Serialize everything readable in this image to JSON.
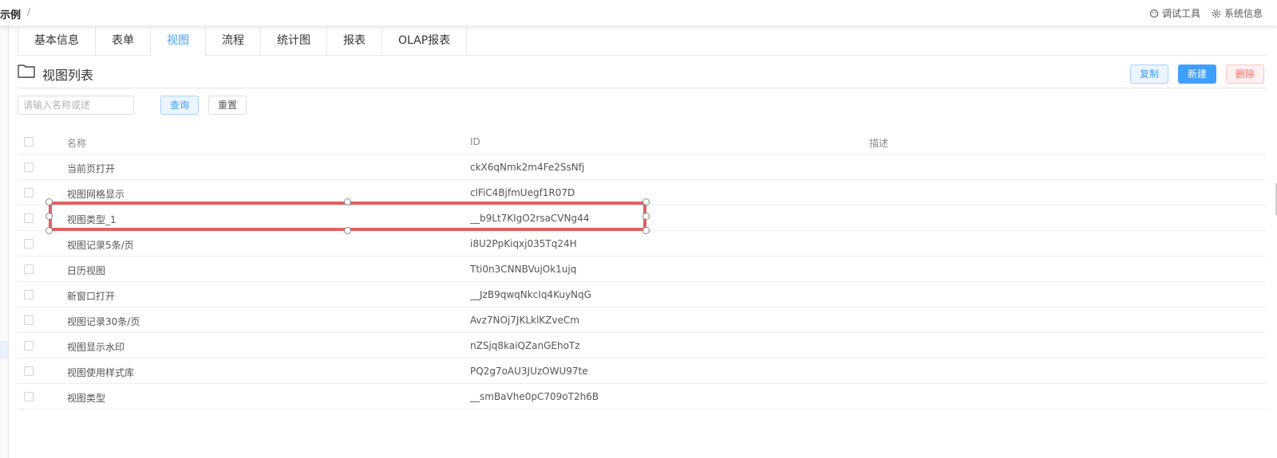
{
  "breadcrumb": {
    "current": "示例",
    "separator": "/"
  },
  "top_actions": [
    {
      "label": "调试工具",
      "icon": "bug-icon"
    },
    {
      "label": "系统信息",
      "icon": "gear-icon"
    }
  ],
  "tabs": [
    {
      "label": "基本信息",
      "active": false
    },
    {
      "label": "表单",
      "active": false
    },
    {
      "label": "视图",
      "active": true
    },
    {
      "label": "流程",
      "active": false
    },
    {
      "label": "统计图",
      "active": false
    },
    {
      "label": "报表",
      "active": false
    },
    {
      "label": "OLAP报表",
      "active": false
    }
  ],
  "section": {
    "title": "视图列表",
    "icon": "folder-icon"
  },
  "toolbar": {
    "copy_label": "复制",
    "new_label": "新建",
    "delete_label": "删除"
  },
  "search": {
    "placeholder": "请输入名称或述",
    "value": "",
    "query_label": "查询",
    "reset_label": "重置"
  },
  "table": {
    "headers": {
      "name": "名称",
      "id": "ID",
      "desc": "描述"
    },
    "rows": [
      {
        "name": "当前页打开",
        "id": "ckX6qNmk2m4Fe2SsNfj",
        "desc": ""
      },
      {
        "name": "视图网格显示",
        "id": "clFiC4BjfmUegf1R07D",
        "desc": ""
      },
      {
        "name": "视图类型_1",
        "id": "__b9Lt7KIgO2rsaCVNg44",
        "desc": ""
      },
      {
        "name": "视图记录5条/页",
        "id": "i8U2PpKiqxj035Tq24H",
        "desc": ""
      },
      {
        "name": "日历视图",
        "id": "Tti0n3CNNBVujOk1ujq",
        "desc": ""
      },
      {
        "name": "新窗口打开",
        "id": "__JzB9qwqNkcIq4KuyNqG",
        "desc": ""
      },
      {
        "name": "视图记录30条/页",
        "id": "Avz7NOj7JKLklKZveCm",
        "desc": ""
      },
      {
        "name": "视图显示水印",
        "id": "nZSjq8kaiQZanGEhoTz",
        "desc": ""
      },
      {
        "name": "视图使用样式库",
        "id": "PQ2g7oAU3JUzOWU97te",
        "desc": ""
      },
      {
        "name": "视图类型",
        "id": "__smBaVhe0pC709oT2h6B",
        "desc": ""
      }
    ]
  },
  "colors": {
    "accent": "#409eff",
    "danger": "#f56c6c",
    "selection": "#e06060"
  }
}
